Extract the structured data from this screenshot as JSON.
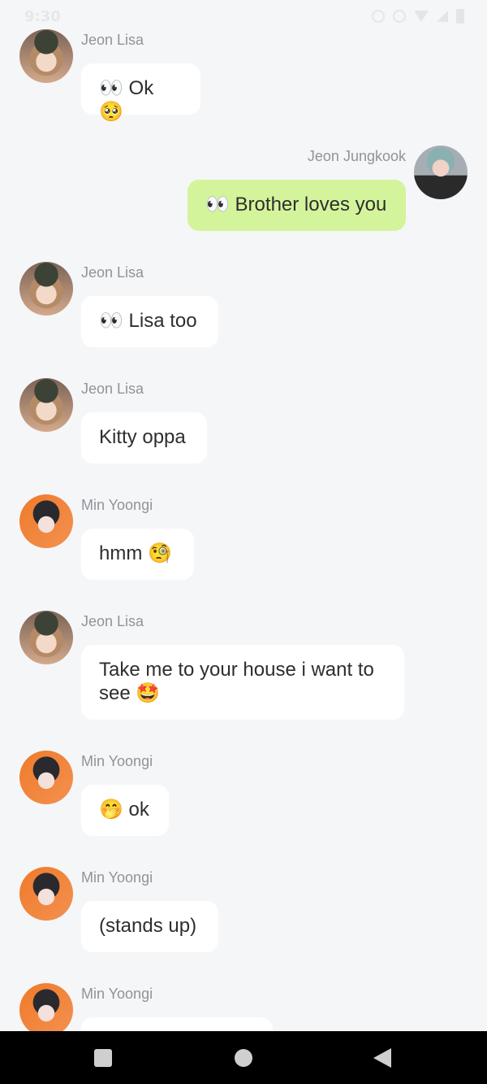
{
  "status_bar": {
    "time": "9:30"
  },
  "messages": [
    {
      "side": "left",
      "sender": "Jeon Lisa",
      "avatar": "lisa",
      "text": "👀 Ok 🥺"
    },
    {
      "side": "right",
      "sender": "Jeon Jungkook",
      "avatar": "jungkook",
      "text": "👀 Brother loves you"
    },
    {
      "side": "left",
      "sender": "Jeon Lisa",
      "avatar": "lisa",
      "text": "👀 Lisa too"
    },
    {
      "side": "left",
      "sender": "Jeon Lisa",
      "avatar": "lisa",
      "text": "Kitty oppa"
    },
    {
      "side": "left",
      "sender": "Min Yoongi",
      "avatar": "yoongi",
      "text": "hmm 🧐"
    },
    {
      "side": "left",
      "sender": "Jeon Lisa",
      "avatar": "lisa",
      "text": "Take me to your house i want to see 🤩"
    },
    {
      "side": "left",
      "sender": "Min Yoongi",
      "avatar": "yoongi",
      "text": "🤭 ok"
    },
    {
      "side": "left",
      "sender": "Min Yoongi",
      "avatar": "yoongi",
      "text": "(stands up)"
    },
    {
      "side": "left",
      "sender": "Min Yoongi",
      "avatar": "yoongi",
      "text": ""
    }
  ],
  "colors": {
    "background": "#f5f6f8",
    "incoming_bubble": "#ffffff",
    "outgoing_bubble": "#d4f49c",
    "sender_name": "#909399"
  },
  "icons": {
    "status": [
      "alarm-icon",
      "call-icon",
      "wifi-icon",
      "signal-icon",
      "battery-icon"
    ],
    "navigation": [
      "recents-icon",
      "home-icon",
      "back-icon"
    ]
  }
}
